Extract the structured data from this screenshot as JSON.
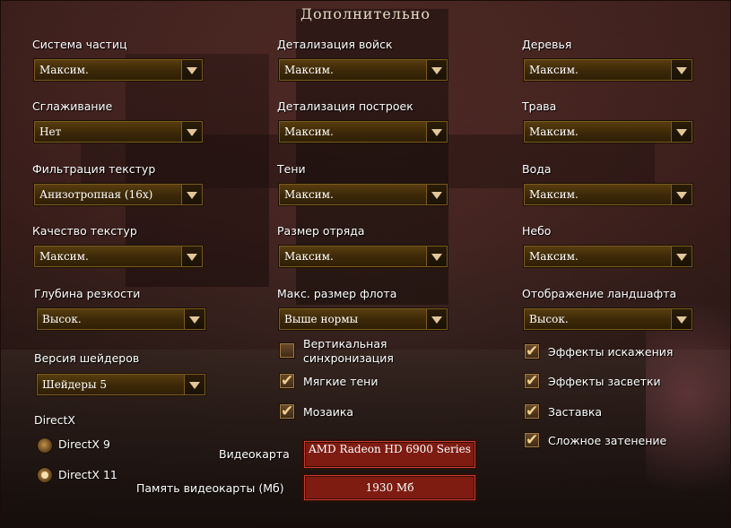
{
  "title": "Дополнительно",
  "col1": {
    "particles_label": "Система частиц",
    "particles_value": "Максим.",
    "aa_label": "Сглаживание",
    "aa_value": "Нет",
    "filter_label": "Фильтрация текстур",
    "filter_value": "Анизотропная (16x)",
    "texq_label": "Качество текстур",
    "texq_value": "Максим.",
    "dof_label": "Глубина резкости",
    "dof_value": "Высок.",
    "shader_label": "Версия шейдеров",
    "shader_value": "Шейдеры 5",
    "directx_label": "DirectX",
    "dx9_label": "DirectX 9",
    "dx9_selected": false,
    "dx11_label": "DirectX 11",
    "dx11_selected": true
  },
  "col2": {
    "unit_label": "Детализация войск",
    "unit_value": "Максим.",
    "building_label": "Детализация построек",
    "building_value": "Максим.",
    "shadows_label": "Тени",
    "shadows_value": "Максим.",
    "squad_label": "Размер отряда",
    "squad_value": "Максим.",
    "fleet_label": "Макс. размер флота",
    "fleet_value": "Выше нормы",
    "vsync_label": "Вертикальная синхронизация",
    "vsync_checked": false,
    "softshadows_label": "Мягкие тени",
    "softshadows_checked": true,
    "mosaic_label": "Мозаика",
    "mosaic_checked": true,
    "gpu_label": "Видеокарта",
    "gpu_value": "AMD Radeon HD 6900 Series",
    "vram_label": "Память видеокарты (Мб)",
    "vram_value": "1930 Мб"
  },
  "col3": {
    "trees_label": "Деревья",
    "trees_value": "Максим.",
    "grass_label": "Трава",
    "grass_value": "Максим.",
    "water_label": "Вода",
    "water_value": "Максим.",
    "sky_label": "Небо",
    "sky_value": "Максим.",
    "terrain_label": "Отображение ландшафта",
    "terrain_value": "Высок.",
    "distortion_label": "Эффекты искажения",
    "distortion_checked": true,
    "bloom_label": "Эффекты засветки",
    "bloom_checked": true,
    "splash_label": "Заставка",
    "splash_checked": true,
    "ssao_label": "Сложное затенение",
    "ssao_checked": true
  },
  "icons": {
    "dropdown": "chevron-down-icon",
    "check": "checkmark-icon"
  },
  "colors": {
    "field_bg": "#7e1c12",
    "dropdown_bg": "#3e2a08",
    "arrow": "#e2c79a"
  }
}
